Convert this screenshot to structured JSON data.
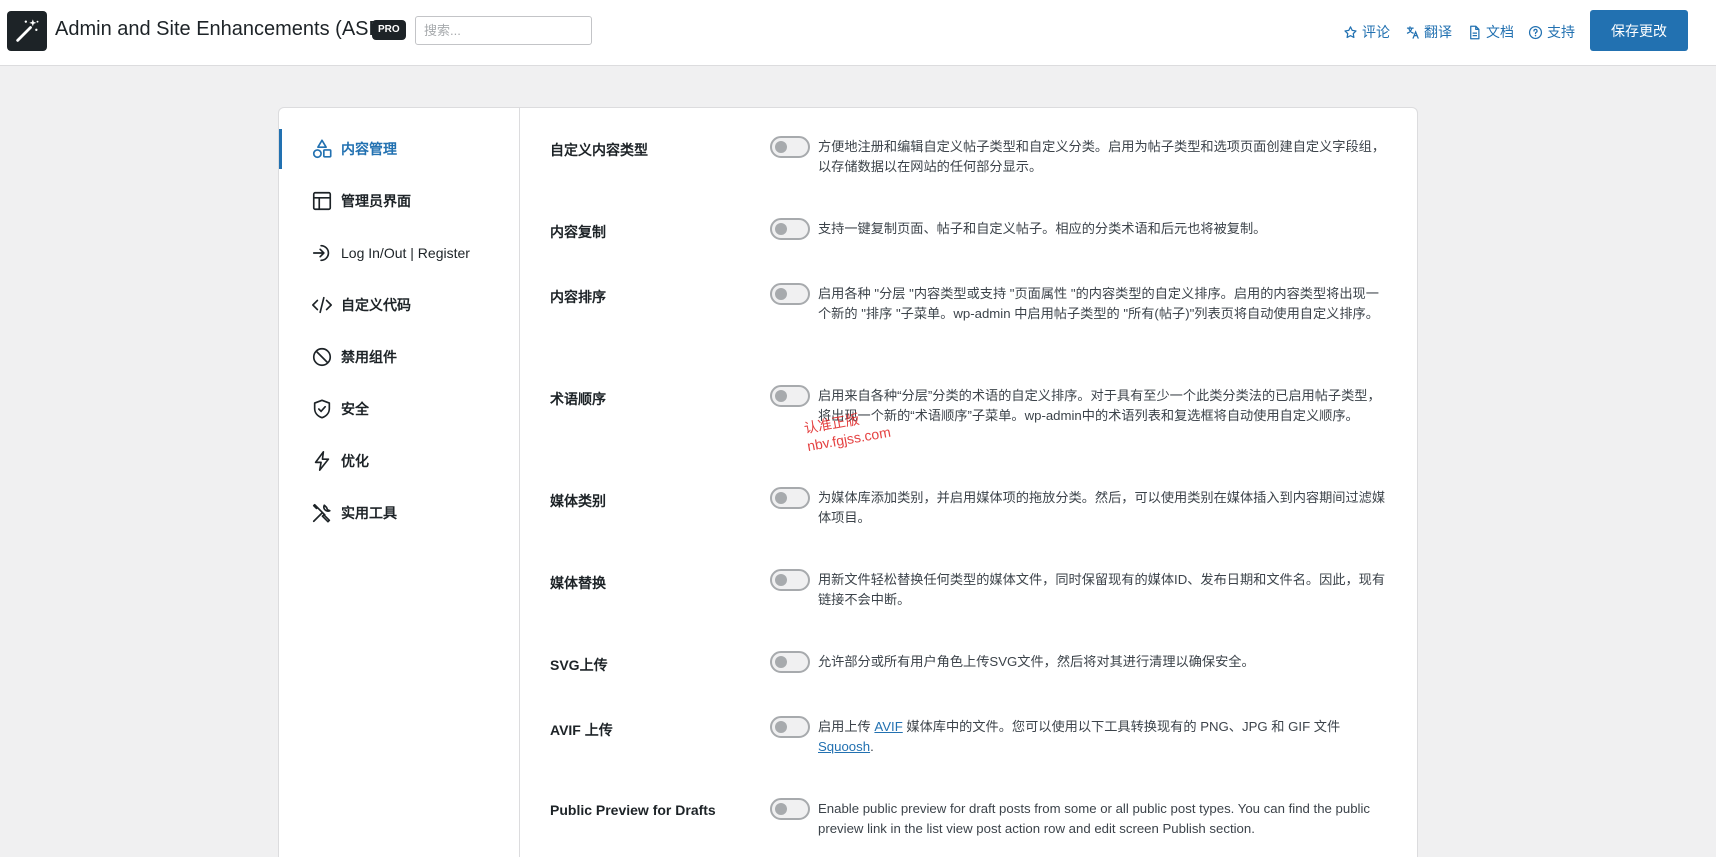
{
  "header": {
    "title": "Admin and Site Enhancements (ASE)",
    "badge": "PRO",
    "search_placeholder": "搜索...",
    "links": [
      {
        "label": "评论",
        "icon": "star-icon"
      },
      {
        "label": "翻译",
        "icon": "translate-icon"
      },
      {
        "label": "文档",
        "icon": "document-icon"
      },
      {
        "label": "支持",
        "icon": "help-icon"
      }
    ],
    "save_label": "保存更改"
  },
  "sidebar": {
    "items": [
      {
        "label": "内容管理",
        "icon": "shapes-icon",
        "active": true
      },
      {
        "label": "管理员界面",
        "icon": "layout-icon"
      },
      {
        "label": "Log In/Out | Register",
        "icon": "login-icon"
      },
      {
        "label": "自定义代码",
        "icon": "code-icon"
      },
      {
        "label": "禁用组件",
        "icon": "disable-icon"
      },
      {
        "label": "安全",
        "icon": "shield-icon"
      },
      {
        "label": "优化",
        "icon": "lightning-icon"
      },
      {
        "label": "实用工具",
        "icon": "tools-icon"
      }
    ]
  },
  "modules": [
    {
      "title": "自定义内容类型",
      "desc": "方便地注册和编辑自定义帖子类型和自定义分类。启用为帖子类型和选项页面创建自定义字段组，以存储数据以在网站的任何部分显示。",
      "enabled": false
    },
    {
      "title": "内容复制",
      "desc": "支持一键复制页面、帖子和自定义帖子。相应的分类术语和后元也将被复制。",
      "enabled": false
    },
    {
      "title": "内容排序",
      "desc": "启用各种 \"分层 \"内容类型或支持 \"页面属性 \"的内容类型的自定义排序。启用的内容类型将出现一个新的 \"排序 \"子菜单。wp-admin 中启用帖子类型的 \"所有(帖子)\"列表页将自动使用自定义排序。",
      "enabled": false
    },
    {
      "title": "术语顺序",
      "desc": "启用来自各种“分层”分类的术语的自定义排序。对于具有至少一个此类分类法的已启用帖子类型，将出现一个新的“术语顺序”子菜单。wp-admin中的术语列表和复选框将自动使用自定义顺序。",
      "enabled": false
    },
    {
      "title": "媒体类别",
      "desc": "为媒体库添加类别，并启用媒体项的拖放分类。然后，可以使用类别在媒体插入到内容期间过滤媒体项目。",
      "enabled": false
    },
    {
      "title": "媒体替换",
      "desc": "用新文件轻松替换任何类型的媒体文件，同时保留现有的媒体ID、发布日期和文件名。因此，现有链接不会中断。",
      "enabled": false
    },
    {
      "title": "SVG上传",
      "desc": "允许部分或所有用户角色上传SVG文件，然后将对其进行清理以确保安全。",
      "enabled": false
    },
    {
      "title": "AVIF 上传",
      "desc_pre": "启用上传 ",
      "desc_link": "AVIF",
      "desc_mid": " 媒体库中的文件。您可以使用以下工具转换现有的 PNG、JPG 和 GIF 文件 ",
      "desc_link2": "Squoosh",
      "desc_post": ".",
      "enabled": false
    },
    {
      "title": "Public Preview for Drafts",
      "desc": "Enable public preview for draft posts from some or all public post types. You can find the public preview link in the list view post action row and edit screen Publish section.",
      "enabled": false
    }
  ],
  "watermark": {
    "line1": "认准正版",
    "line2": "nbv.fgjss.com"
  },
  "colors": {
    "accent": "#2271b1",
    "toggle_off": "#a7aaad"
  }
}
